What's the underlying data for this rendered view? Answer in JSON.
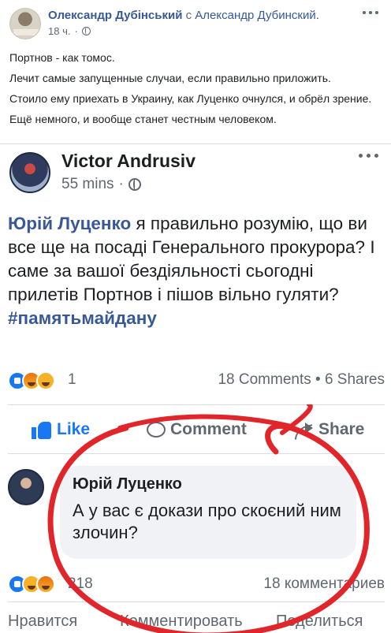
{
  "outer_post": {
    "author": "Олександр Дубінський",
    "with_word": "с",
    "coauthor": "Александр Дубинский.",
    "time": "18 ч.",
    "paragraphs": [
      "Портнов - как томос.",
      "Лечит самые запущенные случаи, если правильно приложить.",
      "Стоило ему приехать в Украину, как Луценко очнулся, и обрёл зрение.",
      "Ещё немного, и вообще станет честным человеком."
    ]
  },
  "inner_post": {
    "author": "Victor Andrusiv",
    "time": "55 mins",
    "mention": "Юрій Луценко",
    "text": " я правильно розумію, що ви все ще на посаді Генерального прокурора? І саме за вашої бездіяльності сьогодні прилетів Портнов і пішов вільно гуляти?",
    "hashtag": "#памятьмайдану",
    "reactions": {
      "icons": [
        "like-icon",
        "angry-icon",
        "haha-icon"
      ],
      "count": "1",
      "summary": "18 Comments • 6 Shares"
    },
    "actions": {
      "like": "Like",
      "comment": "Comment",
      "share": "Share"
    },
    "comment": {
      "author": "Юрій Луценко",
      "text": "А у вас є докази про скоєний ним злочин?"
    },
    "footer_reactions": {
      "icons": [
        "like-icon",
        "haha-icon",
        "angry-icon"
      ],
      "count": "218",
      "summary": "18 комментариев"
    },
    "footer_actions": {
      "like": "Нравится",
      "comment": "Комментировать",
      "share": "Поделиться"
    }
  },
  "colors": {
    "link": "#385898",
    "like_blue": "#1877f2",
    "annotation_red": "#e0262a",
    "muted": "#606770"
  }
}
